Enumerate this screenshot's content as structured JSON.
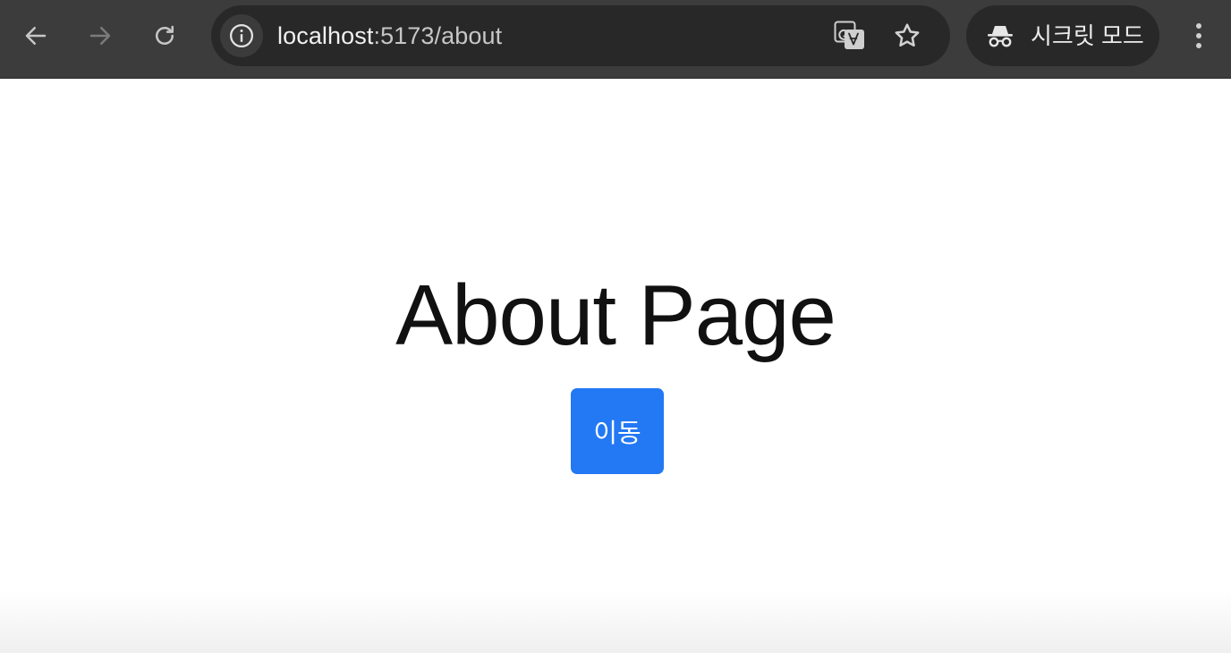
{
  "browser": {
    "url_host": "localhost",
    "url_rest": ":5173/about",
    "incognito_label": "시크릿 모드",
    "icons": {
      "back": "arrow-left-icon",
      "forward": "arrow-right-icon",
      "reload": "reload-icon",
      "site_info": "info-icon",
      "translate": "translate-icon",
      "bookmark": "star-icon",
      "incognito": "incognito-icon",
      "menu": "more-vert-icon"
    },
    "colors": {
      "toolbar": "#3c3c3c",
      "omnibox": "#282828"
    }
  },
  "page": {
    "title": "About Page",
    "button_label": "이동",
    "button_color": "#2378f4"
  }
}
